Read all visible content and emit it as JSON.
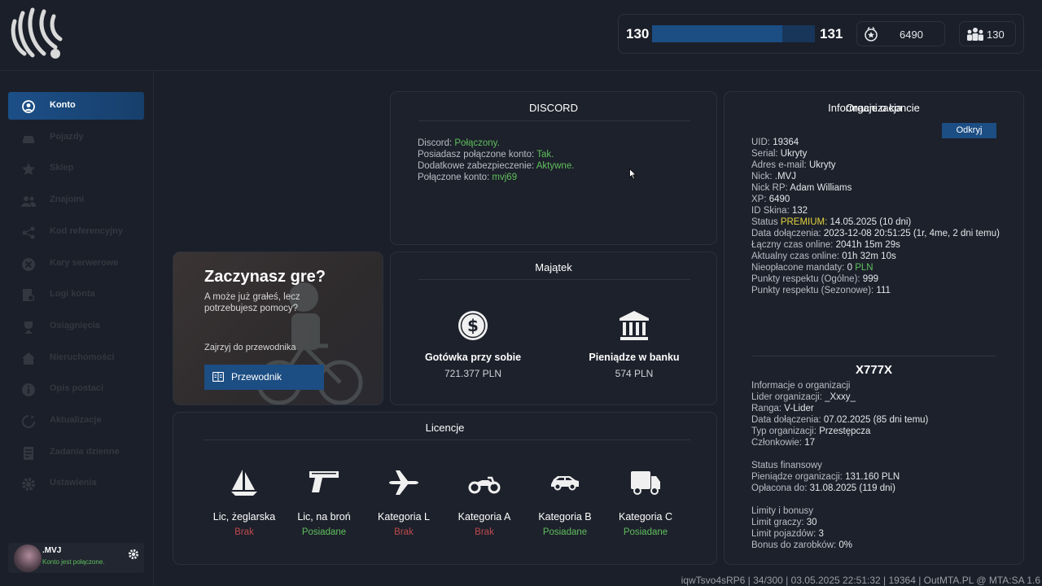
{
  "topbar": {
    "level_current": "130",
    "level_next": "131",
    "level_progress": 0.8,
    "xp_value": "6490",
    "friends_value": "130"
  },
  "sidebar": {
    "items": [
      {
        "label": "Konto",
        "icon": "account-icon",
        "active": true
      },
      {
        "label": "Pojazdy",
        "icon": "car-icon"
      },
      {
        "label": "Sklep",
        "icon": "star-icon"
      },
      {
        "label": "Znajomi",
        "icon": "friends-icon"
      },
      {
        "label": "Kod referencyjny",
        "icon": "referral-icon"
      },
      {
        "label": "Kary serwerowe",
        "icon": "ban-icon"
      },
      {
        "label": "Logi konta",
        "icon": "logs-icon"
      },
      {
        "label": "Osiągnięcia",
        "icon": "trophy-icon"
      },
      {
        "label": "Nieruchomości",
        "icon": "house-icon"
      },
      {
        "label": "Opis postaci",
        "icon": "info-icon"
      },
      {
        "label": "Aktualizacje",
        "icon": "update-icon"
      },
      {
        "label": "Zadania dzienne",
        "icon": "tasks-icon"
      },
      {
        "label": "Ustawienia",
        "icon": "gear-icon"
      }
    ],
    "user": {
      "name": ".MVJ",
      "status": "Konto jest połączone."
    }
  },
  "discord": {
    "title": "DISCORD",
    "rows": [
      {
        "label": "Discord: ",
        "value": "Połączony."
      },
      {
        "label": "Posiadasz połączone konto: ",
        "value": "Tak."
      },
      {
        "label": "Dodatkowe zabezpieczenie: ",
        "value": "Aktywne."
      },
      {
        "label": "Połączone konto: ",
        "value": "mvj69"
      }
    ]
  },
  "guide": {
    "title": "Zaczynasz gre?",
    "subtitle": "A może już grałeś, lecz potrzebujesz pomocy?",
    "hint": "Zajrzyj do przewodnika",
    "button": "Przewodnik"
  },
  "assets": {
    "title": "Majątek",
    "cash_label": "Gotówka przy sobie",
    "cash_value": "721.377 PLN",
    "bank_label": "Pieniądze w banku",
    "bank_value": "574 PLN"
  },
  "licenses": {
    "title": "Licencje",
    "items": [
      {
        "name": "Lic, żeglarska",
        "state": "Brak",
        "owned": false,
        "icon": "sailboat-icon"
      },
      {
        "name": "Lic, na broń",
        "state": "Posiadane",
        "owned": true,
        "icon": "pistol-icon"
      },
      {
        "name": "Kategoria L",
        "state": "Brak",
        "owned": false,
        "icon": "plane-icon"
      },
      {
        "name": "Kategoria A",
        "state": "Brak",
        "owned": false,
        "icon": "motorcycle-icon"
      },
      {
        "name": "Kategoria B",
        "state": "Posiadane",
        "owned": true,
        "icon": "car-icon"
      },
      {
        "name": "Kategoria C",
        "state": "Posiadane",
        "owned": true,
        "icon": "truck-icon"
      }
    ]
  },
  "account": {
    "title": "Informacje o koncie",
    "reveal_button": "Odkryj",
    "uid_label": "UID: ",
    "uid": "19364",
    "serial_label": "Serial: ",
    "serial": "Ukryty",
    "email_label": "Adres e-mail: ",
    "email": "Ukryty",
    "nick_label": "Nick: ",
    "nick": ".MVJ",
    "nick_rp_label": "Nick RP: ",
    "nick_rp": "Adam Williams",
    "xp_label": "XP: ",
    "xp": "6490",
    "skin_label": "ID Skina: ",
    "skin": "132",
    "status_label": "Status ",
    "status_tier": "PREMIUM:",
    "status_value": " 14.05.2025 (10 dni)",
    "joined_label": "Data dołączenia: ",
    "joined": "2023-12-08 20:51:25 (1r, 4me, 2 dni temu)",
    "total_online_label": "Łączny czas online: ",
    "total_online": "2041h 15m 29s",
    "current_online_label": "Aktualny czas online: ",
    "current_online": "01h 32m 10s",
    "fines_label": "Nieopłacone mandaty: ",
    "fines": "0",
    "fines_currency": " PLN",
    "respect_general_label": "Punkty respektu (Ogólne): ",
    "respect_general": "999",
    "respect_season_label": "Punkty respektu (Sezonowe): ",
    "respect_season": "111"
  },
  "organization": {
    "title": "Organizacja",
    "name": "X777X",
    "info_header": "Informacje o organizacji",
    "leader_label": "Lider organizacji: ",
    "leader": "_Xxxy_",
    "rank_label": "Ranga: ",
    "rank": "V-Lider",
    "joined_label": "Data dołączenia: ",
    "joined": "07.02.2025 (85 dni temu)",
    "type_label": "Typ organizacji: ",
    "type": "Przestępcza",
    "members_label": "Członkowie: ",
    "members": "17",
    "finance_header": "Status finansowy",
    "money_label": "Pieniądze organizacji: ",
    "money": "131.160 PLN",
    "paid_label": "Opłacona do: ",
    "paid": "31.08.2025 (119 dni)",
    "limits_header": "Limity i bonusy",
    "players_limit_label": "Limit graczy: ",
    "players_limit": "30",
    "vehicles_limit_label": "Limit pojazdów: ",
    "vehicles_limit": "3",
    "bonus_label": "Bonus do zarobków: ",
    "bonus": "0%"
  },
  "footer": {
    "text": "iqwTsvo4sRP6 | 34/300 | 03.05.2025 22:51:32 | 19364 | OutMTA.PL @ MTA:SA 1.6"
  },
  "colors": {
    "accent": "#1c4d83",
    "green": "#5fbf5d",
    "red": "#c0484c",
    "premium": "#e2d33d",
    "background": "#1b1f29"
  }
}
